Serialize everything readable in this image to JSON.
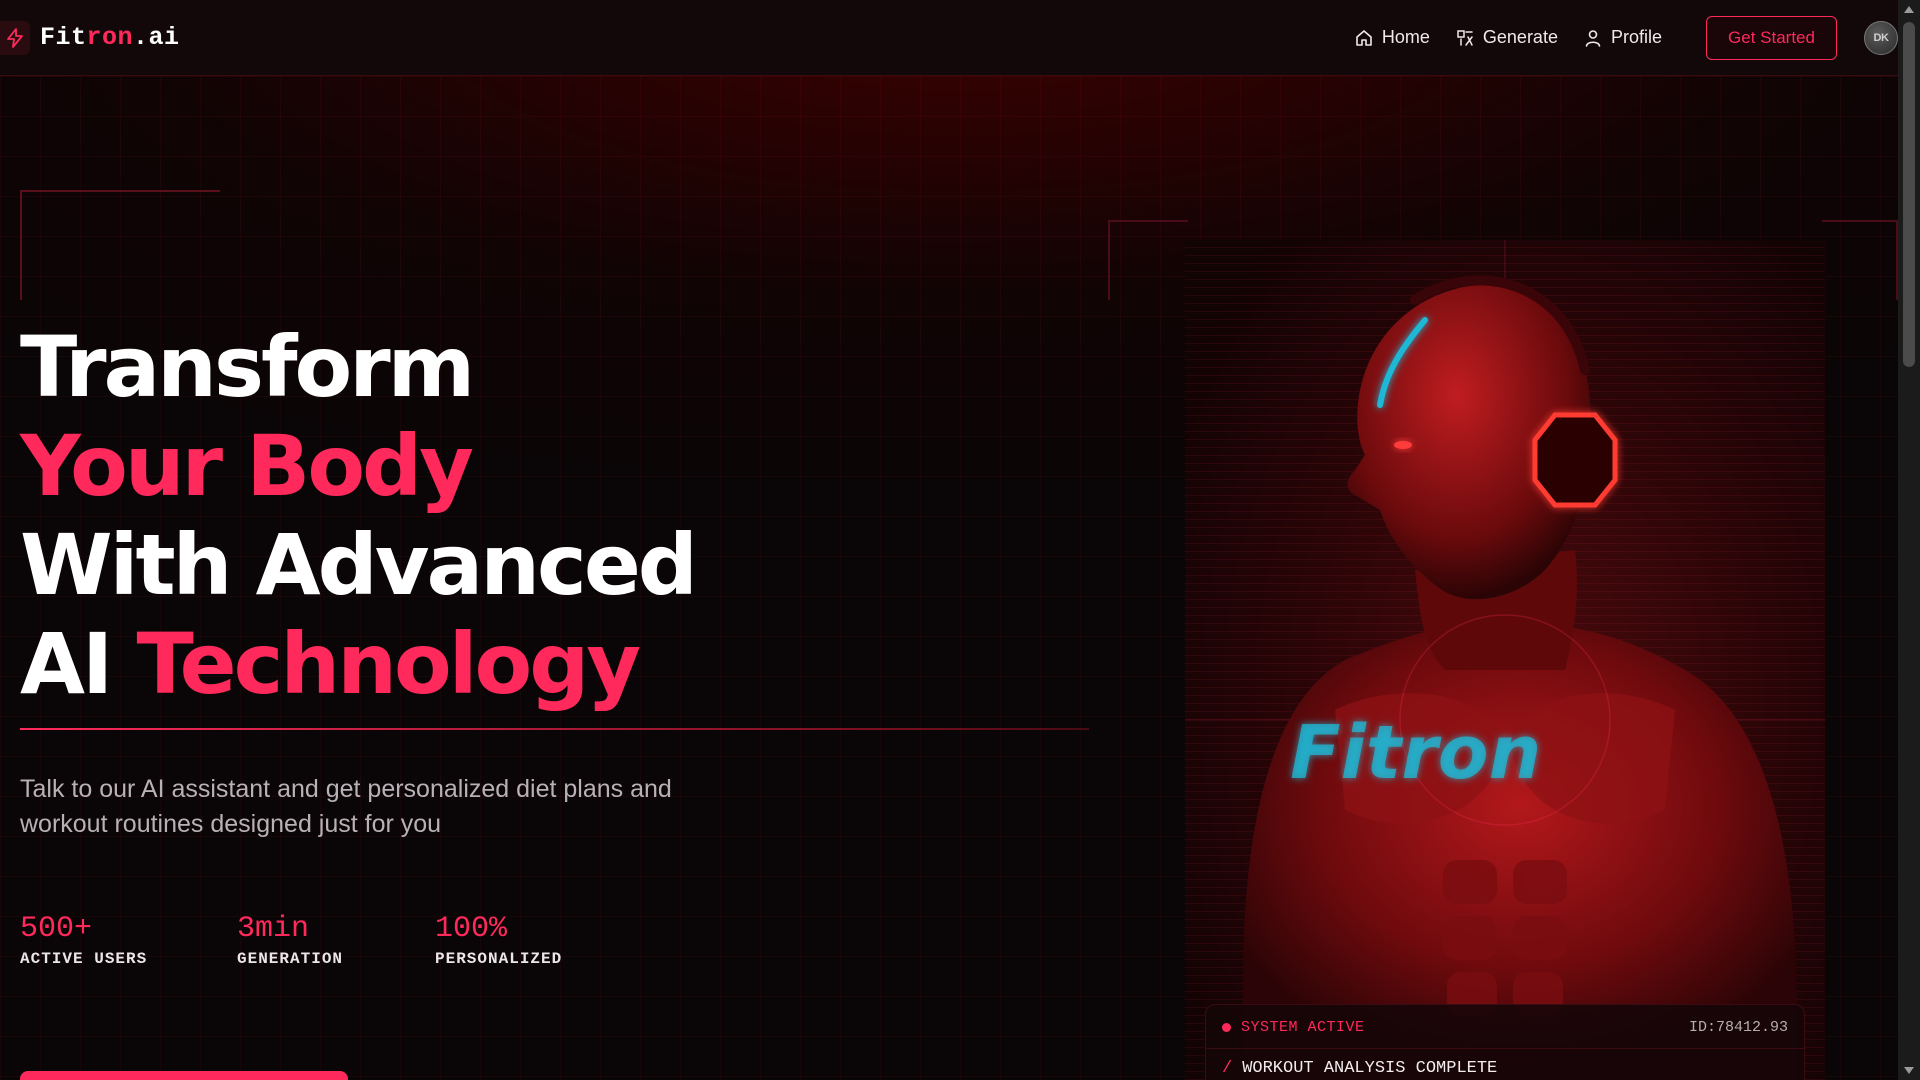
{
  "brand": {
    "name_prefix": "Fit",
    "name_accent": "ron",
    "name_suffix": ".ai",
    "icon": "bolt-icon"
  },
  "nav": {
    "items": [
      {
        "label": "Home",
        "icon": "home-icon"
      },
      {
        "label": "Generate",
        "icon": "generate-icon"
      },
      {
        "label": "Profile",
        "icon": "user-icon"
      }
    ],
    "cta_label": "Get Started",
    "avatar_text": "DK"
  },
  "hero": {
    "line1": "Transform",
    "line2": "Your Body",
    "line3": "With Advanced",
    "line4_a": "AI ",
    "line4_b": "Technology",
    "subtitle": "Talk to our AI assistant and get personalized diet plans and workout routines designed just for you",
    "stats": [
      {
        "value": "500+",
        "label": "ACTIVE USERS"
      },
      {
        "value": "3min",
        "label": "GENERATION"
      },
      {
        "value": "100%",
        "label": "PERSONALIZED"
      }
    ]
  },
  "visual": {
    "chest_text": "Fitron"
  },
  "status": {
    "label": "SYSTEM ACTIVE",
    "id": "ID:78412.93",
    "message": "WORKOUT ANALYSIS COMPLETE"
  },
  "colors": {
    "accent": "#ff2a5b",
    "background": "#0a0506",
    "cyan": "#1fb8d6"
  }
}
